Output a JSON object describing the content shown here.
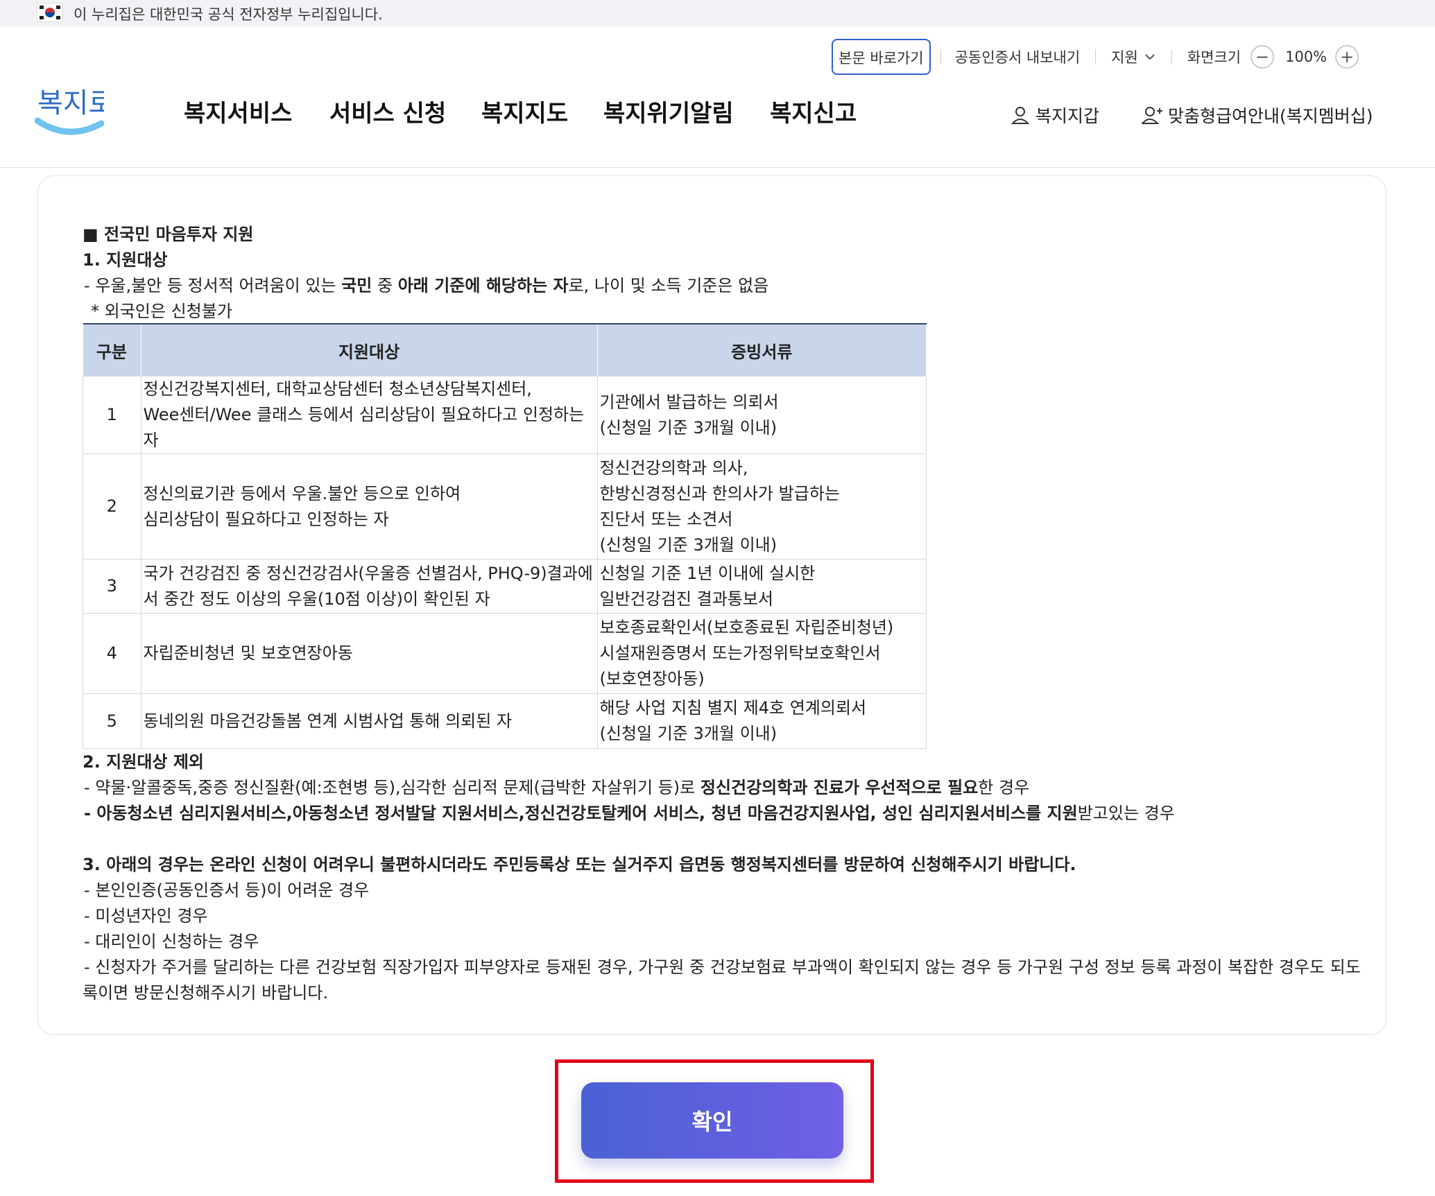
{
  "gov_banner": {
    "text": "이 누리집은 대한민국 공식 전자정부 누리집입니다."
  },
  "utility": {
    "skip": "본문 바로가기",
    "cert_export": "공동인증서 내보내기",
    "support": "지원",
    "screen_size": "화면크기",
    "zoom": "100%",
    "minus": "−",
    "plus": "+"
  },
  "logo": {
    "text": "복지로"
  },
  "nav": [
    "복지서비스",
    "서비스 신청",
    "복지지도",
    "복지위기알림",
    "복지신고"
  ],
  "right_links": {
    "wallet": "복지지갑",
    "membership": "맞춤형급여안내(복지멤버십)"
  },
  "content": {
    "section_title": "■ 전국민 마음투자 지원",
    "s1_title": "1. 지원대상",
    "s1_line_a": "- 우울,불안 등 정서적 어려움이 있는 ",
    "s1_line_b": "국민",
    "s1_line_c": " 중 ",
    "s1_line_d": "아래 기준에 해당하는 자",
    "s1_line_e": "로, 나이 및 소득 기준은 없음",
    "s1_note": "* 외국인은 신청불가",
    "table_headers": [
      "구분",
      "지원대상",
      "증빙서류"
    ],
    "table_rows": [
      {
        "no": "1",
        "target": [
          "정신건강복지센터, 대학교상담센터 청소년상담복지센터,",
          "Wee센터/Wee 클래스 등에서 심리상담이 필요하다고 인정하는 자"
        ],
        "docs": [
          "기관에서 발급하는 의뢰서",
          "(신청일 기준 3개월 이내)"
        ]
      },
      {
        "no": "2",
        "target": [
          "정신의료기관 등에서 우울.불안 등으로 인하여",
          "심리상담이 필요하다고 인정하는 자"
        ],
        "docs": [
          "정신건강의학과 의사,",
          "한방신경정신과 한의사가 발급하는",
          "진단서 또는 소견서",
          "(신청일 기준 3개월 이내)"
        ]
      },
      {
        "no": "3",
        "target": [
          "국가 건강검진 중 정신건강검사(우울증 선별검사, PHQ-9)결과에",
          "서 중간 정도 이상의 우울(10점 이상)이 확인된 자"
        ],
        "docs": [
          "신청일 기준 1년 이내에 실시한",
          "일반건강검진 결과통보서"
        ]
      },
      {
        "no": "4",
        "target": [
          "자립준비청년 및 보호연장아동"
        ],
        "docs": [
          "보호종료확인서(보호종료된 자립준비청년)",
          "시설재원증명서 또는가정위탁보호확인서",
          "(보호연장아동)"
        ]
      },
      {
        "no": "5",
        "target": [
          "동네의원 마음건강돌봄 연계 시범사업 통해 의뢰된 자"
        ],
        "docs": [
          "해당 사업 지침 별지 제4호 연계의뢰서",
          "(신청일 기준 3개월 이내)"
        ]
      }
    ],
    "s2_title": "2. 지원대상 제외",
    "s2_l1_a": "- 약물·알콜중독,중증 정신질환(예:조현병 등),심각한 심리적 문제(급박한 자살위기 등)로 ",
    "s2_l1_b": "정신건강의학과 진료가 우선적으로 필요",
    "s2_l1_c": "한 경우",
    "s2_l2_a": "- 아동청소년 심리지원서비스,아동청소년 정서발달 지원서비스,정신건강토탈케어 서비스, 청년 마음건강지원사업, 성인 심리지원서비스를 지원",
    "s2_l2_b": "받고있는 경우",
    "s3_title": "3. 아래의 경우는 온라인 신청이 어려우니 불편하시더라도 주민등록상 또는 실거주지 읍면동 행정복지센터를 방문하여 신청해주시기 바랍니다.",
    "s3_items": [
      "- 본인인증(공동인증서 등)이 어려운 경우",
      "- 미성년자인 경우",
      "- 대리인이 신청하는 경우"
    ],
    "s3_last_1": "- 신청자가 주거를 달리하는 다른 건강보험 직장가입자 피부양자로 등재된 경우, 가구원 중 건강보험료 부과액이 확인되지 않는 경우 등 가구원 구성 정보 등록 과정이 복잡한 경우도 되도",
    "s3_last_2": "록이면 방문신청해주시기 바랍니다."
  },
  "confirm": {
    "label": "확인"
  },
  "colors": {
    "accent": "#2f5fd1",
    "header_bg": "#c8d5ea",
    "highlight": "#e30016",
    "button_start": "#4a61d4",
    "button_end": "#7060e4"
  }
}
